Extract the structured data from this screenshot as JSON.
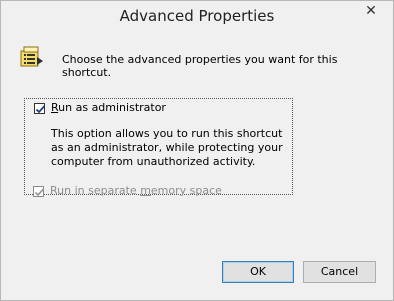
{
  "window": {
    "title": "Advanced Properties",
    "close_glyph": "✕"
  },
  "header": {
    "icon": "shortcut-properties-icon",
    "text": "Choose the advanced properties you want for this shortcut."
  },
  "run_as_admin": {
    "label_underlined": "R",
    "label_rest": "un as administrator",
    "checked": true,
    "description": "This option allows you to run this shortcut as an administrator, while protecting your computer from unauthorized activity."
  },
  "separate_memory": {
    "label_prefix": "Run in separate ",
    "label_underlined": "m",
    "label_rest": "emory space",
    "checked": true,
    "enabled": false
  },
  "buttons": {
    "ok": "OK",
    "cancel": "Cancel"
  },
  "colors": {
    "check_enabled": "#1f3d7a",
    "check_disabled": "#9a9a9a",
    "ok_border": "#3c7fb1"
  }
}
